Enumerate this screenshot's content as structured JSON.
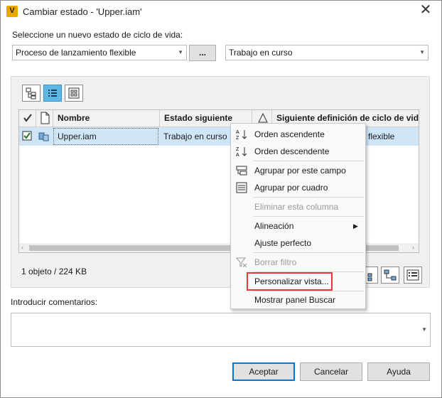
{
  "window": {
    "title": "Cambiar estado - 'Upper.iam'",
    "app_icon_letter": "V"
  },
  "lifecycle": {
    "label": "Seleccione un nuevo estado de ciclo de vida:",
    "definition_value": "Proceso de lanzamiento flexible",
    "browse_label": "...",
    "state_value": "Trabajo en curso"
  },
  "grid": {
    "headers": {
      "nombre": "Nombre",
      "estado": "Estado siguiente",
      "siguiente_def": "Siguiente definición de ciclo de vida"
    },
    "row": {
      "nombre": "Upper.iam",
      "estado": "Trabajo en curso",
      "siguiente_def": "flexible",
      "checked": true
    }
  },
  "status": {
    "count_text": "1 objeto / 224 KB"
  },
  "context_menu": {
    "orden_asc": "Orden ascendente",
    "orden_desc": "Orden descendente",
    "agrupar_campo": "Agrupar por este campo",
    "agrupar_cuadro": "Agrupar por cuadro",
    "eliminar_columna": "Eliminar esta columna",
    "alineacion": "Alineación",
    "ajuste": "Ajuste perfecto",
    "borrar_filtro": "Borrar filtro",
    "personalizar": "Personalizar vista...",
    "mostrar_panel": "Mostrar panel Buscar"
  },
  "comments": {
    "label": "Introducir comentarios:",
    "value": ""
  },
  "buttons": {
    "accept": "Aceptar",
    "cancel": "Cancelar",
    "help": "Ayuda"
  },
  "colors": {
    "accent": "#0078d7",
    "selection": "#cfe6f9",
    "highlight_box": "#e03a3a",
    "toolbar_active": "#5fb7e6"
  }
}
